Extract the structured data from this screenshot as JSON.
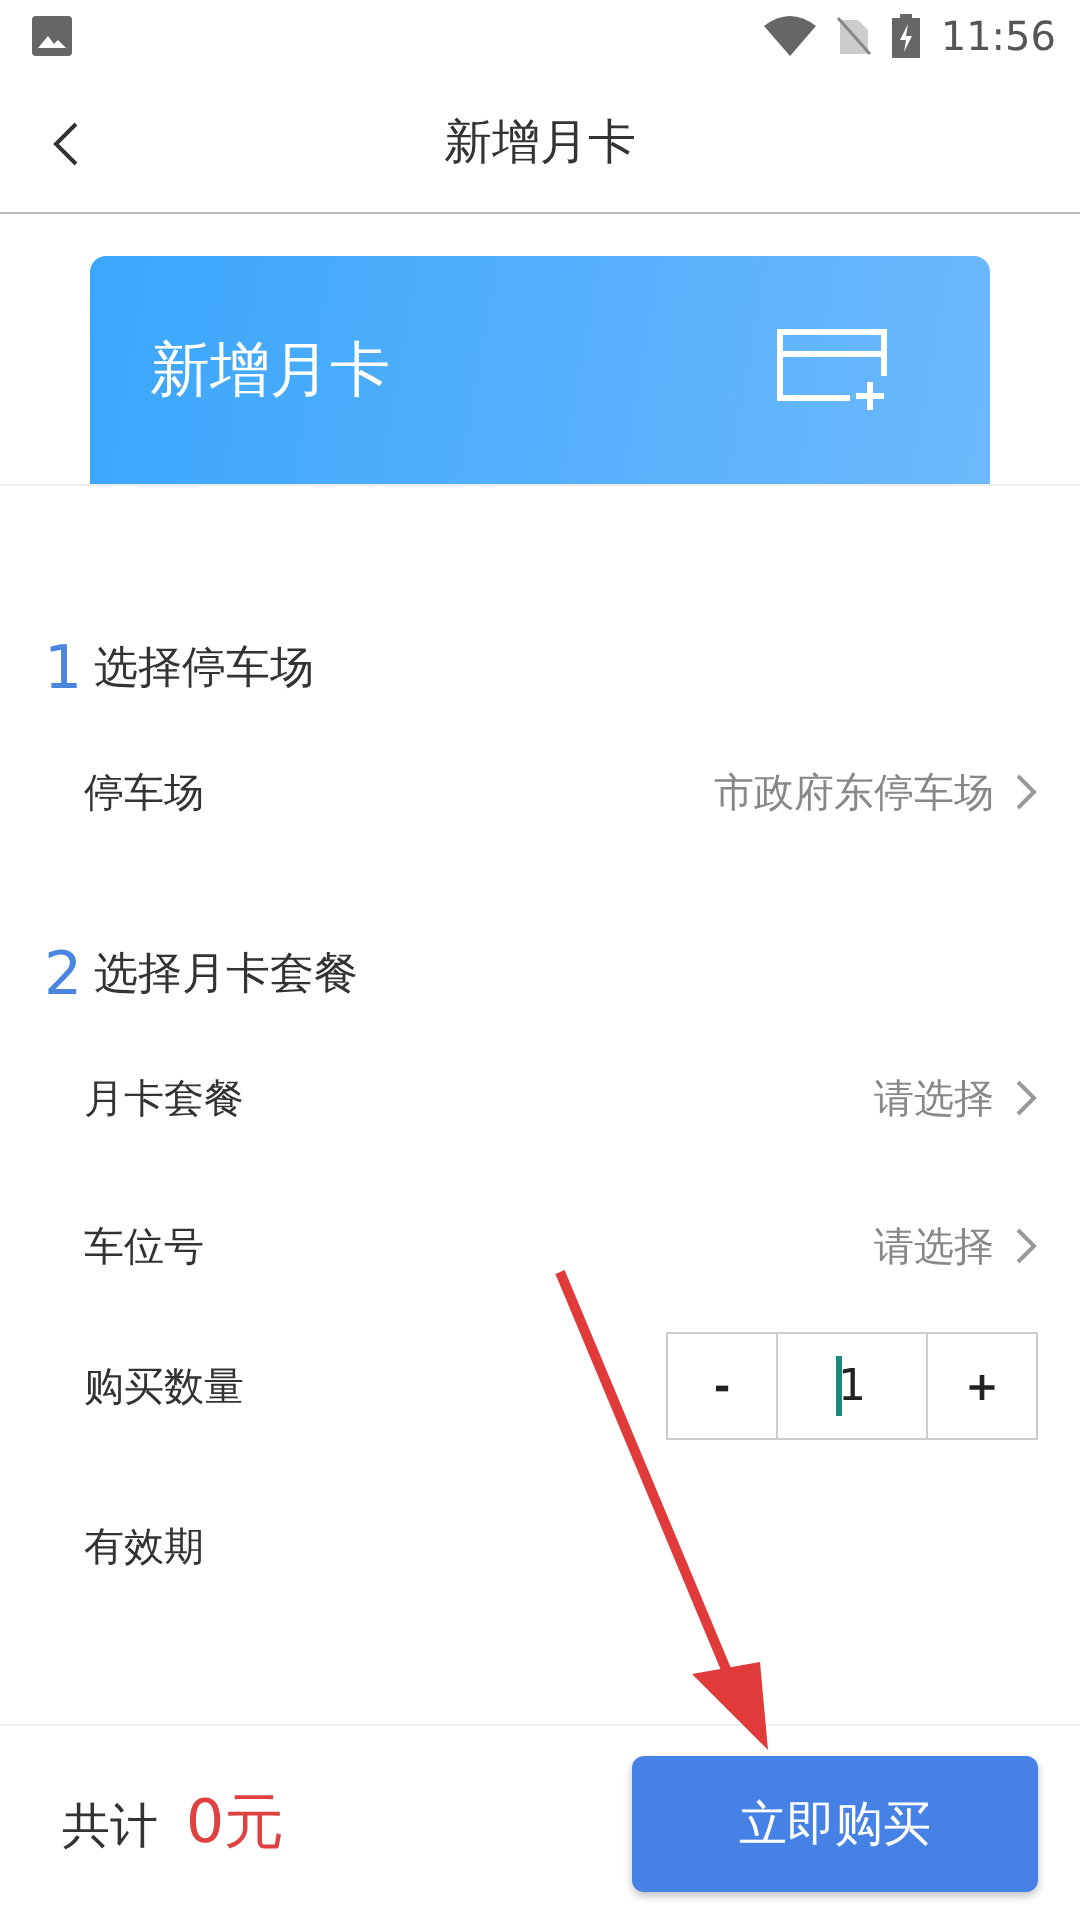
{
  "status_bar": {
    "time": "11:56"
  },
  "header": {
    "title": "新增月卡"
  },
  "banner": {
    "title": "新增月卡"
  },
  "sections": [
    {
      "number": "1",
      "title": "选择停车场",
      "rows": [
        {
          "kind": "select",
          "label": "停车场",
          "value": "市政府东停车场"
        }
      ]
    },
    {
      "number": "2",
      "title": "选择月卡套餐",
      "rows": [
        {
          "kind": "select",
          "label": "月卡套餐",
          "placeholder": "请选择"
        },
        {
          "kind": "select",
          "label": "车位号",
          "placeholder": "请选择"
        },
        {
          "kind": "stepper",
          "label": "购买数量",
          "minus": "-",
          "value": "1",
          "plus": "+"
        },
        {
          "kind": "plain",
          "label": "有效期"
        }
      ]
    }
  ],
  "footer": {
    "total_label": "共计",
    "total_value": "0元",
    "buy_button": "立即购买"
  }
}
